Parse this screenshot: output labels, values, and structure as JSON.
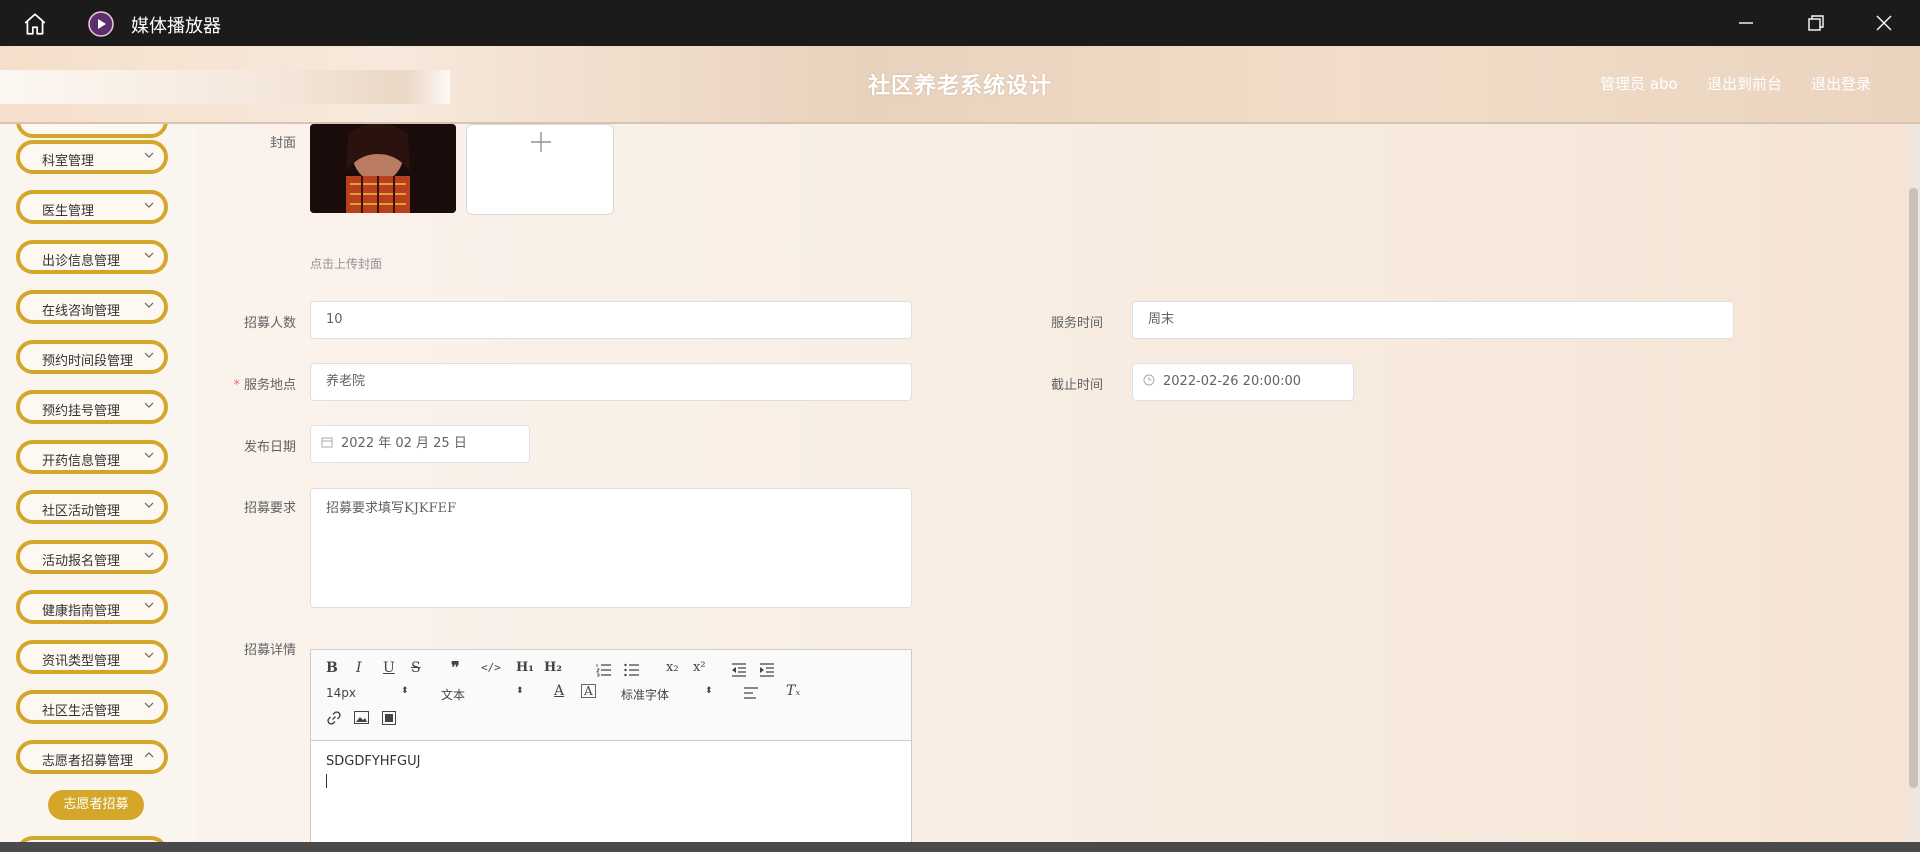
{
  "window": {
    "title": "媒体播放器"
  },
  "header": {
    "title": "社区养老系统设计",
    "admin_label": "管理员 abo",
    "front_label": "退出到前台",
    "logout_label": "退出登录"
  },
  "sidebar": {
    "items": [
      {
        "label": "科室管理"
      },
      {
        "label": "医生管理"
      },
      {
        "label": "出诊信息管理"
      },
      {
        "label": "在线咨询管理"
      },
      {
        "label": "预约时间段管理"
      },
      {
        "label": "预约挂号管理"
      },
      {
        "label": "开药信息管理"
      },
      {
        "label": "社区活动管理"
      },
      {
        "label": "活动报名管理"
      },
      {
        "label": "健康指南管理"
      },
      {
        "label": "资讯类型管理"
      },
      {
        "label": "社区生活管理"
      },
      {
        "label": "志愿者招募管理"
      }
    ],
    "sub_item": "志愿者招募"
  },
  "form": {
    "cover_label": "封面",
    "upload_hint": "点击上传封面",
    "recruit_count_label": "招募人数",
    "recruit_count_value": "10",
    "service_time_label": "服务时间",
    "service_time_value": "周末",
    "service_place_label": "服务地点",
    "service_place_required": "*",
    "service_place_value": "养老院",
    "deadline_label": "截止时间",
    "deadline_value": "2022-02-26 20:00:00",
    "publish_date_label": "发布日期",
    "publish_date_value": "2022 年 02 月 25 日",
    "requirement_label": "招募要求",
    "requirement_value": "招募要求填写KJKFEF",
    "detail_label": "招募详情"
  },
  "editor": {
    "font_size": "14px",
    "format": "文本",
    "font_family": "标准字体",
    "content": "SDGDFYHFGUJ"
  },
  "icons": {
    "home": "home-icon",
    "app_logo": "play-icon",
    "minimize": "minimize-icon",
    "maximize": "restore-icon",
    "close": "close-icon"
  },
  "colors": {
    "accent": "#d4a62a",
    "titlebar": "#1b1b1b",
    "required": "#f56c6c"
  }
}
